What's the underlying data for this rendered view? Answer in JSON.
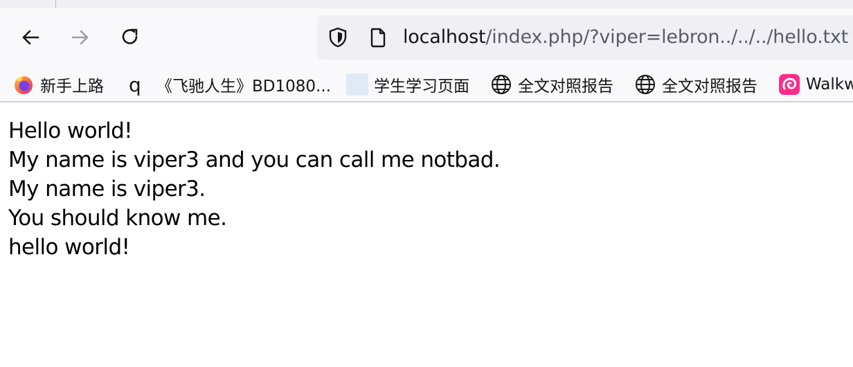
{
  "browser": {
    "url": {
      "host": "localhost",
      "path": "/index.php/?viper=lebron../../../hello.txt"
    },
    "bookmarks": [
      {
        "label": "新手上路",
        "icon": "firefox-icon"
      },
      {
        "label": "《飞驰人生》BD1080...",
        "icon": "q-icon",
        "glyph": "q"
      },
      {
        "label": "学生学习页面",
        "icon": "blank-page-icon"
      },
      {
        "label": "全文对照报告",
        "icon": "globe-icon"
      },
      {
        "label": "全文对照报告",
        "icon": "globe-icon"
      },
      {
        "label": "Walkw",
        "icon": "swirl-icon"
      }
    ]
  },
  "page": {
    "lines": [
      "Hello world!",
      "My name is viper3 and you can call me notbad.",
      "My name is viper3.",
      "You should know me.",
      "hello world!"
    ]
  },
  "colors": {
    "toolbar_bg": "#f9f9fb",
    "urlbar_bg": "#f0f0f4",
    "firefox_orange": "#ff7139",
    "firefox_purple": "#7542e5",
    "swirl_pink": "#ff2a8a"
  }
}
